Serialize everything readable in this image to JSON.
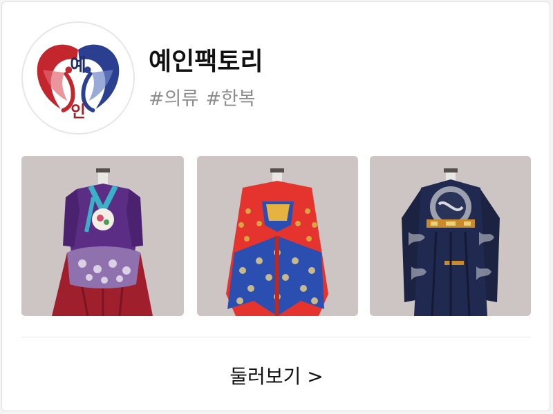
{
  "shop": {
    "name": "예인팩토리",
    "tags": [
      "#의류",
      "#한복"
    ],
    "logo": {
      "icon": "twin-crane-logo-icon",
      "text_top": "예",
      "text_bottom": "인",
      "colors": {
        "left": "#c4262e",
        "right": "#2a3f8f"
      }
    }
  },
  "products": [
    {
      "icon": "purple-hanbok-image",
      "colors": {
        "jacket": "#5b2d85",
        "skirt": "#a01f2c"
      }
    },
    {
      "icon": "red-blue-robe-image",
      "colors": {
        "robe": "#e4342d",
        "cape": "#2a4fb0"
      }
    },
    {
      "icon": "navy-dragon-robe-image",
      "colors": {
        "robe": "#1b2242"
      }
    }
  ],
  "footer": {
    "browse_label": "둘러보기 >"
  }
}
